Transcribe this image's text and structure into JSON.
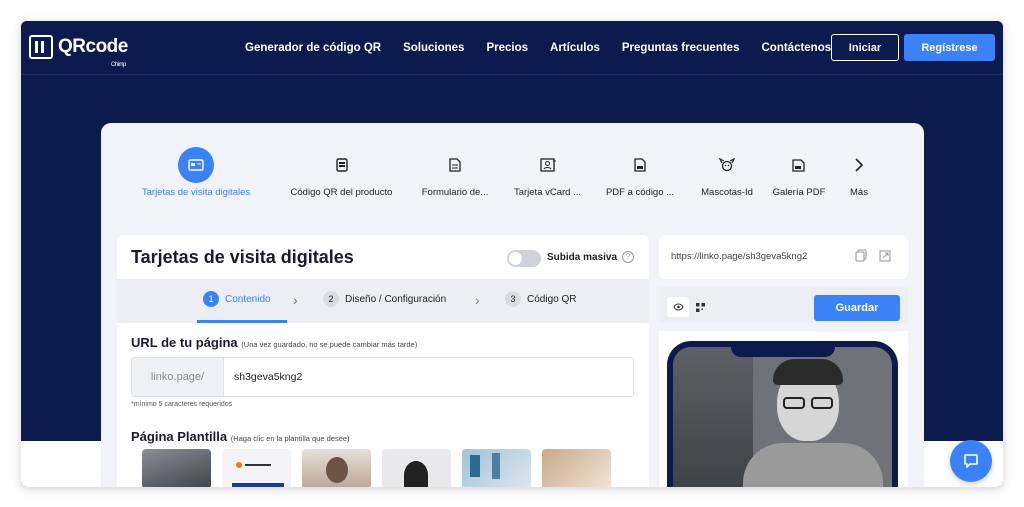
{
  "brand": {
    "name": "QRcode",
    "sub": "Chimp"
  },
  "nav": {
    "links": [
      "Generador de código QR",
      "Soluciones",
      "Precios",
      "Artículos",
      "Preguntas frecuentes",
      "Contáctenos"
    ],
    "login": "Iniciar",
    "register": "Regístrese"
  },
  "categories": [
    {
      "label": "Tarjetas de visita digitales",
      "icon": "id-card-icon",
      "active": true
    },
    {
      "label": "Código QR del producto",
      "icon": "product-icon"
    },
    {
      "label": "Formulario de...",
      "icon": "form-icon"
    },
    {
      "label": "Tarjeta vCard ...",
      "icon": "vcard-icon"
    },
    {
      "label": "PDF a código ...",
      "icon": "pdf-icon"
    },
    {
      "label": "Mascotas-Id",
      "icon": "pet-icon"
    },
    {
      "label": "Galería PDF",
      "icon": "pdf-gallery-icon"
    },
    {
      "label": "Más",
      "icon": "chevron-right-icon"
    }
  ],
  "editor": {
    "title": "Tarjetas de visita digitales",
    "bulk_label": "Subida masiva",
    "steps": [
      {
        "num": "1",
        "label": "Contenido",
        "active": true
      },
      {
        "num": "2",
        "label": "Diseño / Configuración"
      },
      {
        "num": "3",
        "label": "Código QR"
      }
    ],
    "url_title": "URL de tu página",
    "url_note": "(Una vez guardado, no se puede cambiar más tarde)",
    "url_prefix": "linko.page/",
    "url_value": "sh3geva5kng2",
    "url_hint": "*mínimo 5 caracteres requeridos",
    "template_title": "Página Plantilla",
    "template_note": "(Haga clic en la plantilla que desee)"
  },
  "preview": {
    "link": "https://linko.page/sh3geva5kng2",
    "save": "Guardar"
  },
  "colors": {
    "navy": "#0d1a4d",
    "accent": "#3b82f6"
  }
}
